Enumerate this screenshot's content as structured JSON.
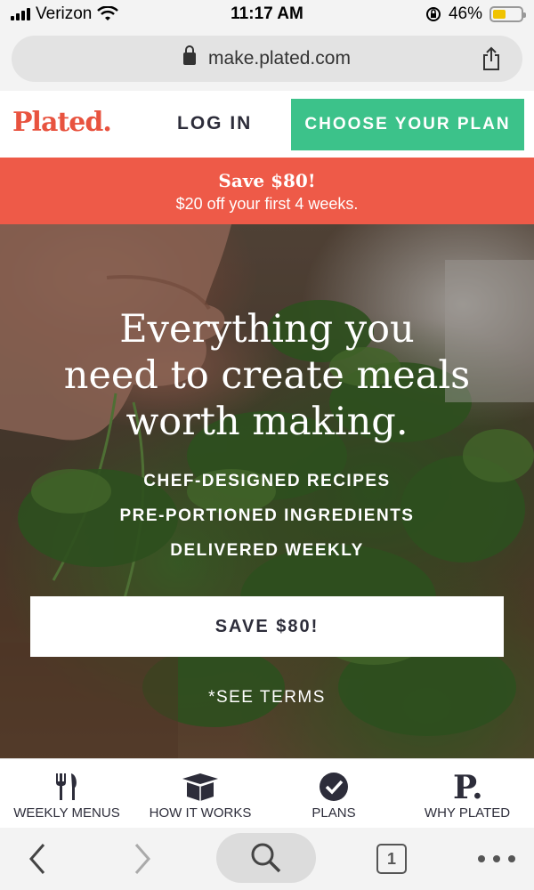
{
  "status_bar": {
    "carrier": "Verizon",
    "time": "11:17 AM",
    "battery": "46%",
    "battery_level": 0.46
  },
  "browser": {
    "url": "make.plated.com",
    "tab_count": "1"
  },
  "header": {
    "logo": "Plated.",
    "login": "LOG IN",
    "choose_plan": "CHOOSE YOUR PLAN"
  },
  "promo": {
    "title": "Save $80!",
    "subtitle": "$20 off your first 4 weeks."
  },
  "hero": {
    "title_lines": [
      "Everything you",
      "need to create meals",
      "worth making."
    ],
    "bullets": [
      "CHEF-DESIGNED RECIPES",
      "PRE-PORTIONED INGREDIENTS",
      "DELIVERED WEEKLY"
    ],
    "cta": "SAVE $80!",
    "terms": "*SEE TERMS"
  },
  "bottom_nav": {
    "items": [
      {
        "label": "WEEKLY MENUS",
        "icon": "utensils-icon"
      },
      {
        "label": "HOW IT WORKS",
        "icon": "box-icon"
      },
      {
        "label": "PLANS",
        "icon": "checkmark-circle-icon"
      },
      {
        "label": "WHY PLATED",
        "icon": "plated-p-icon"
      }
    ]
  },
  "colors": {
    "brand_red": "#ee5a48",
    "cta_green": "#3cc28a",
    "text_dark": "#2d2d3a"
  }
}
